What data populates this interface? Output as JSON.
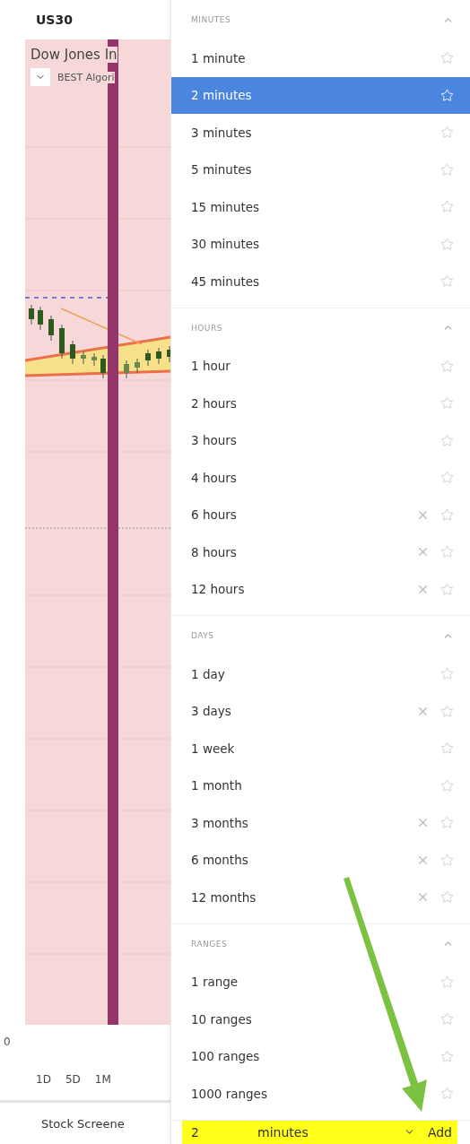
{
  "symbol": "US30",
  "chart": {
    "title": "Dow Jones In",
    "indicator": "BEST Algori",
    "axis_label": "0"
  },
  "ranges": [
    {
      "label": "1D"
    },
    {
      "label": "5D"
    },
    {
      "label": "1M"
    }
  ],
  "footer_tab": "Stock Screene",
  "sections": [
    {
      "title": "MINUTES",
      "expanded": true,
      "items": [
        {
          "label": "1 minute",
          "selected": false,
          "removable": false
        },
        {
          "label": "2 minutes",
          "selected": true,
          "removable": false
        },
        {
          "label": "3 minutes",
          "selected": false,
          "removable": false
        },
        {
          "label": "5 minutes",
          "selected": false,
          "removable": false
        },
        {
          "label": "15 minutes",
          "selected": false,
          "removable": false
        },
        {
          "label": "30 minutes",
          "selected": false,
          "removable": false
        },
        {
          "label": "45 minutes",
          "selected": false,
          "removable": false
        }
      ]
    },
    {
      "title": "HOURS",
      "expanded": true,
      "items": [
        {
          "label": "1 hour",
          "selected": false,
          "removable": false
        },
        {
          "label": "2 hours",
          "selected": false,
          "removable": false
        },
        {
          "label": "3 hours",
          "selected": false,
          "removable": false
        },
        {
          "label": "4 hours",
          "selected": false,
          "removable": false
        },
        {
          "label": "6 hours",
          "selected": false,
          "removable": true
        },
        {
          "label": "8 hours",
          "selected": false,
          "removable": true
        },
        {
          "label": "12 hours",
          "selected": false,
          "removable": true
        }
      ]
    },
    {
      "title": "DAYS",
      "expanded": true,
      "items": [
        {
          "label": "1 day",
          "selected": false,
          "removable": false
        },
        {
          "label": "3 days",
          "selected": false,
          "removable": true
        },
        {
          "label": "1 week",
          "selected": false,
          "removable": false
        },
        {
          "label": "1 month",
          "selected": false,
          "removable": false
        },
        {
          "label": "3 months",
          "selected": false,
          "removable": true
        },
        {
          "label": "6 months",
          "selected": false,
          "removable": true
        },
        {
          "label": "12 months",
          "selected": false,
          "removable": true
        }
      ]
    },
    {
      "title": "RANGES",
      "expanded": true,
      "items": [
        {
          "label": "1 range",
          "selected": false,
          "removable": false
        },
        {
          "label": "10 ranges",
          "selected": false,
          "removable": false
        },
        {
          "label": "100 ranges",
          "selected": false,
          "removable": false
        },
        {
          "label": "1000 ranges",
          "selected": false,
          "removable": false
        }
      ]
    }
  ],
  "add_bar": {
    "value": "2",
    "unit": "minutes",
    "button": "Add"
  }
}
